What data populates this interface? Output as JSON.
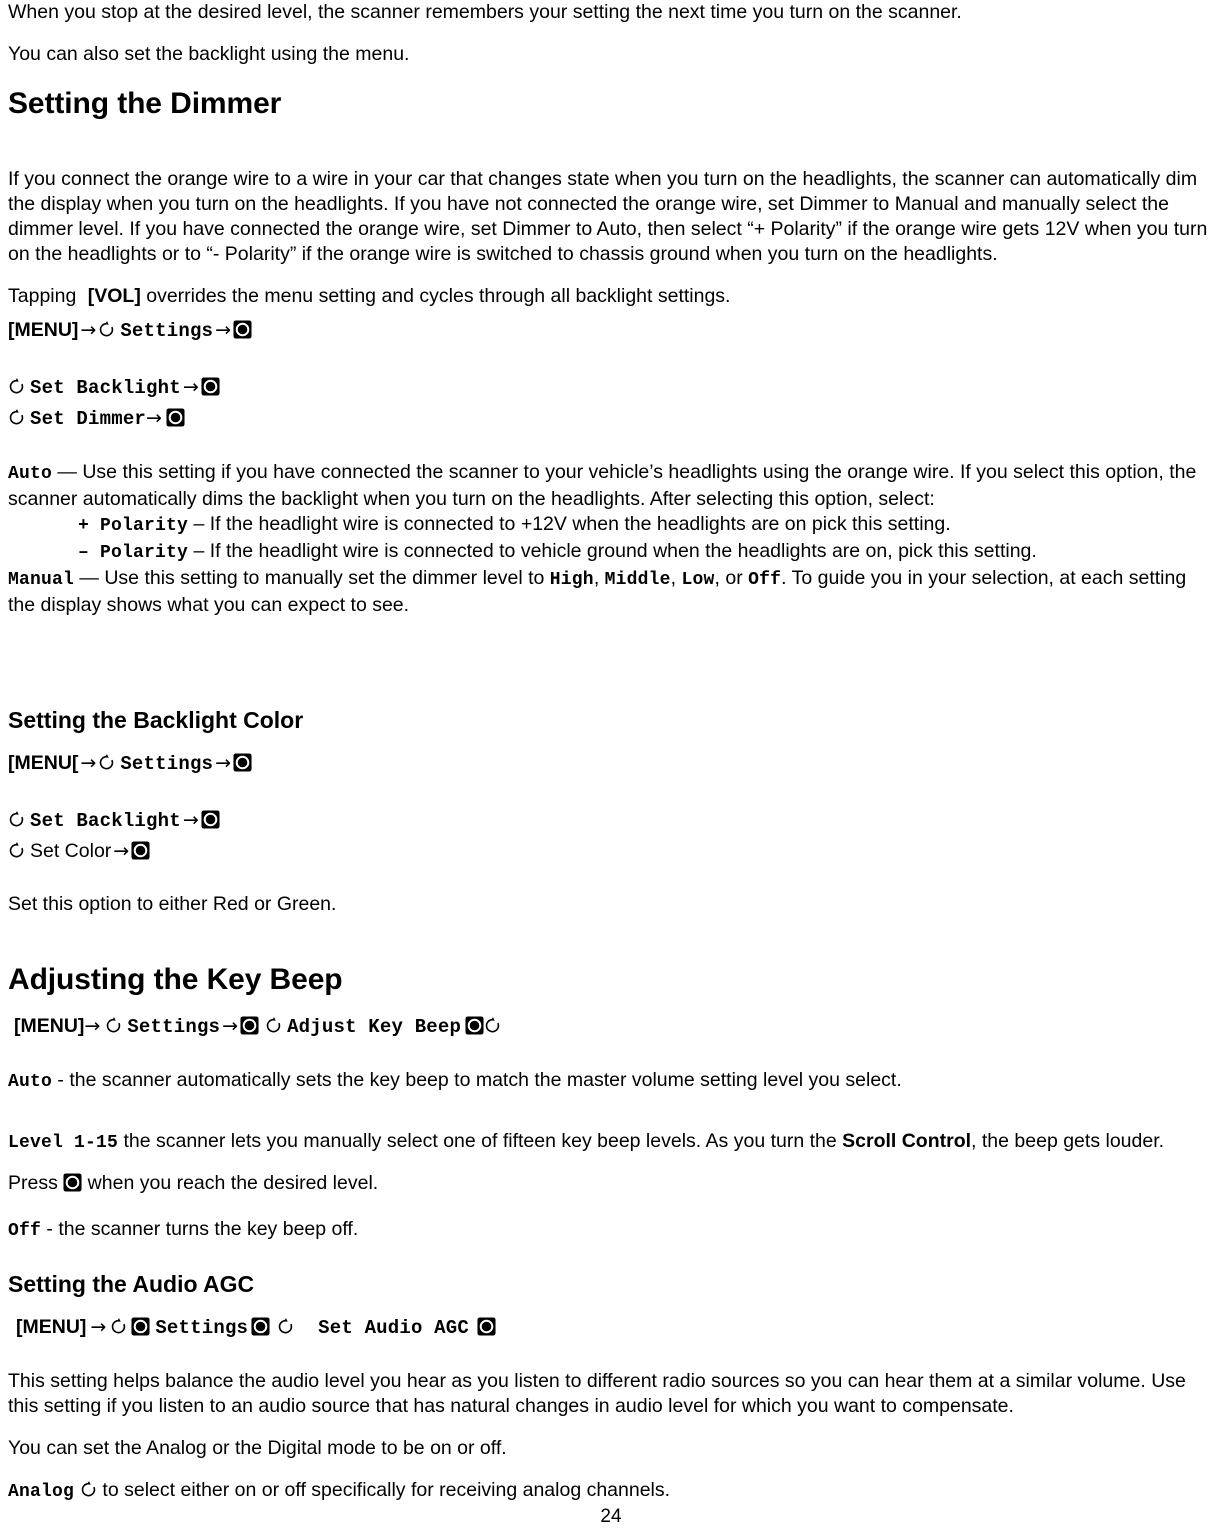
{
  "document": {
    "page_number": "24"
  },
  "icons": {
    "scroll_control": "scroll-control-icon",
    "select_button": "select-button-icon",
    "arrow": "→"
  },
  "intro": {
    "p1": "When you stop at the desired level, the scanner remembers your setting the next time you turn on the scanner.",
    "p2": "You can also set the backlight using the menu."
  },
  "dimmer": {
    "heading": "Setting the Dimmer",
    "body": "If you connect the orange wire to a wire in your car that changes state when you turn on the headlights, the scanner can automatically dim the display when you turn on the headlights. If you have not connected the orange wire, set Dimmer to Manual and manually select the dimmer level. If you have connected the orange wire, set Dimmer to Auto, then select “+ Polarity” if the orange wire gets 12V when you turn on the headlights or to “- Polarity” if the orange wire is switched to chassis ground when you turn on the headlights.",
    "tapping_prefix": "Tapping",
    "tapping_key": "[VOL]",
    "tapping_suffix": "overrides the menu setting and cycles through all backlight settings.",
    "nav": {
      "menu_key": "[MENU]",
      "settings_label": "Settings",
      "set_backlight_label": "Set Backlight",
      "set_dimmer_label": "Set Dimmer"
    },
    "auto": {
      "term": "Auto",
      "text": " — Use this setting if you have connected the scanner to your vehicle’s headlights using the orange wire. If you select this option, the scanner automatically dims the backlight when you turn on the headlights. After selecting this option, select:"
    },
    "plus_polarity": {
      "term": "+ Polarity",
      "text": " – If the headlight wire is connected to +12V when the headlights are on pick this setting."
    },
    "minus_polarity": {
      "term": "– Polarity",
      "text": " – If the headlight wire is connected to vehicle ground when the headlights are on, pick this setting."
    },
    "manual": {
      "term": "Manual",
      "text_1": " — Use this setting to manually set the dimmer level to ",
      "opt_high": "High",
      "sep_1": ", ",
      "opt_middle": "Middle",
      "sep_2": ", ",
      "opt_low": "Low",
      "sep_3": ", or ",
      "opt_off": "Off",
      "text_2": ". To guide you in your selection, at each setting the display shows what you can expect to see."
    }
  },
  "backlight_color": {
    "heading": "Setting the Backlight Color",
    "nav": {
      "menu_key": "[MENU[",
      "settings_label": "Settings",
      "set_backlight_label": "Set Backlight",
      "set_color_label": "Set Color"
    },
    "body": "Set this option to either Red or Green."
  },
  "key_beep": {
    "heading": "Adjusting the Key Beep",
    "nav": {
      "menu_key": "[MENU]",
      "settings_label": "Settings",
      "adjust_key_beep_label": "Adjust Key Beep"
    },
    "auto": {
      "term": "Auto",
      "text": " - the scanner automatically sets the key beep to match the master volume setting level you select."
    },
    "level": {
      "term": "Level 1-15",
      "text_1": "  the scanner lets you manually select one of fifteen key beep levels. As you turn the ",
      "scroll_control_label": "Scroll Control",
      "text_2": ", the beep gets louder. Press ",
      "text_3": " when you reach the desired level."
    },
    "off": {
      "term": "Off",
      "text": " - the scanner turns the key beep off."
    }
  },
  "audio_agc": {
    "heading": "Setting the Audio AGC",
    "nav": {
      "menu_key": "[MENU]",
      "settings_label": "Settings",
      "set_audio_agc_label": "Set Audio AGC"
    },
    "p1": "This setting helps balance the audio level you hear as you listen to different radio sources so you can hear them at a similar volume. Use this setting if you listen to an audio source that has natural changes in audio level for which you want to compensate.",
    "p2": "You can set the Analog or the Digital mode to be on or off.",
    "analog": {
      "term": "Analog",
      "text": " to select either on or off specifically for receiving analog channels."
    }
  }
}
